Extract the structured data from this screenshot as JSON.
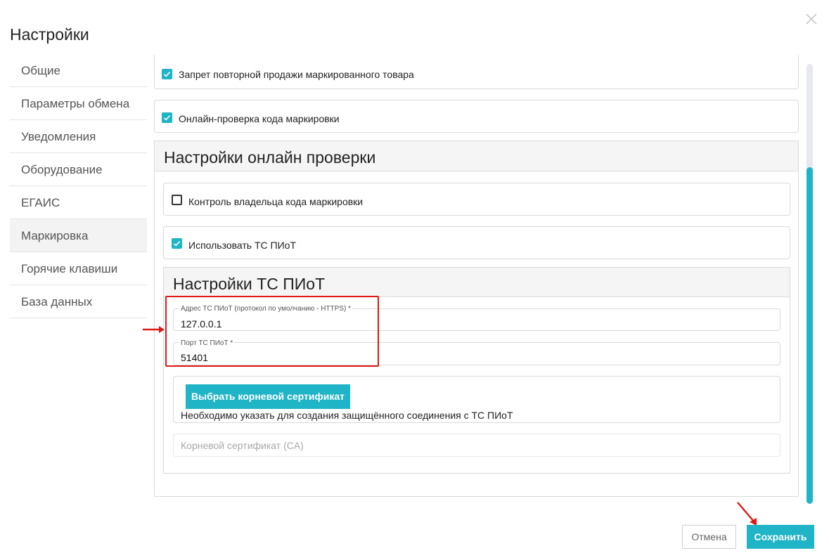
{
  "dialog": {
    "title": "Настройки"
  },
  "sidebar": {
    "items": [
      {
        "label": "Общие"
      },
      {
        "label": "Параметры обмена"
      },
      {
        "label": "Уведомления"
      },
      {
        "label": "Оборудование"
      },
      {
        "label": "ЕГАИС"
      },
      {
        "label": "Маркировка",
        "active": true
      },
      {
        "label": "Горячие клавиши"
      },
      {
        "label": "База данных"
      }
    ]
  },
  "main": {
    "options": [
      {
        "label": "Запрет повторной продажи маркированного товара",
        "checked": true
      },
      {
        "label": "Онлайн-проверка кода маркировки",
        "checked": true
      }
    ],
    "online_check": {
      "title": "Настройки онлайн проверки",
      "options": [
        {
          "label": "Контроль владельца кода маркировки",
          "checked": false
        },
        {
          "label": "Использовать ТС ПИоТ",
          "checked": true
        }
      ],
      "piot": {
        "title": "Настройки ТС ПИоТ",
        "address": {
          "label": "Адрес ТС ПИоТ (протокол по умолчанию - HTTPS) *",
          "value": "127.0.0.1"
        },
        "port": {
          "label": "Порт ТС ПИоТ *",
          "value": "51401"
        },
        "cert_button": "Выбрать корневой сертификат",
        "cert_hint": "Необходимо указать для создания защищённого соединения с ТС ПИоТ",
        "cert_placeholder": "Корневой сертификат (CA)"
      }
    }
  },
  "footer": {
    "cancel": "Отмена",
    "save": "Сохранить"
  },
  "colors": {
    "accent": "#1fb4c6",
    "annotation": "#e01818"
  },
  "icons": {
    "close": "close-icon",
    "check": "check-icon"
  }
}
